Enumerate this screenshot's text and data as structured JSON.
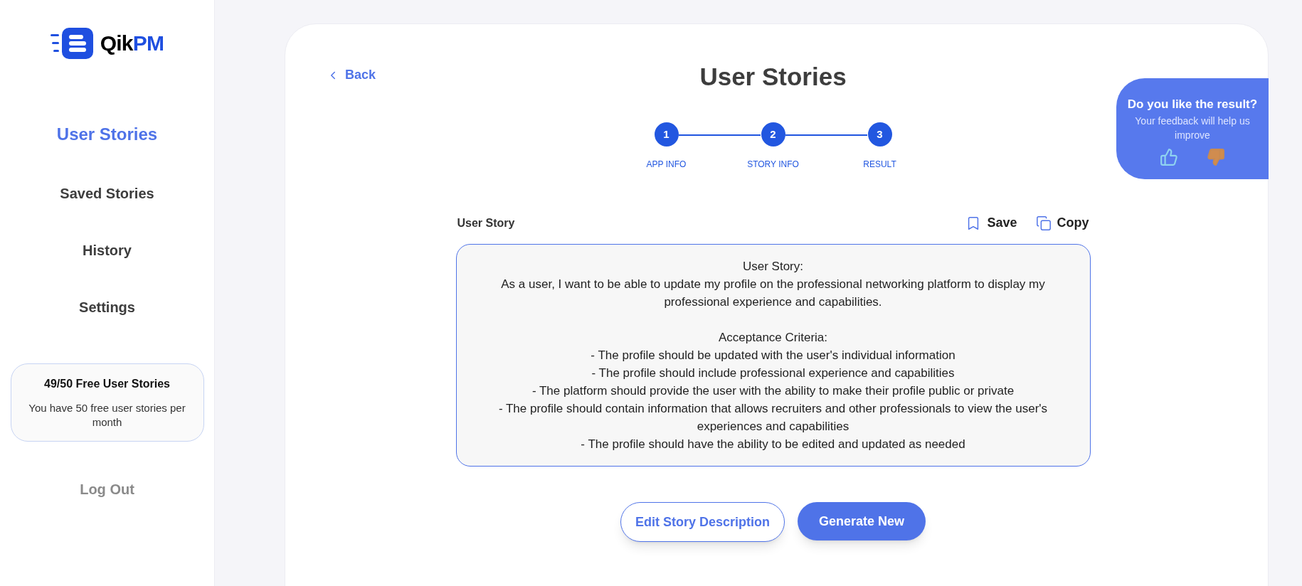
{
  "logo": {
    "first": "Qik",
    "second": "PM"
  },
  "sidebar": {
    "items": [
      {
        "label": "User Stories",
        "selected": true
      },
      {
        "label": "Saved Stories",
        "selected": false
      },
      {
        "label": "History",
        "selected": false
      },
      {
        "label": "Settings",
        "selected": false
      }
    ],
    "quota": {
      "title": "49/50 Free User Stories",
      "text": "You have 50 free user stories per month"
    },
    "logout": "Log Out"
  },
  "back": "Back",
  "title": "User Stories",
  "steps": [
    {
      "number": "1",
      "label": "APP INFO",
      "done": true
    },
    {
      "number": "2",
      "label": "STORY INFO",
      "done": true
    },
    {
      "number": "3",
      "label": "RESULT",
      "done": true
    }
  ],
  "story": {
    "label": "User Story",
    "actions": [
      "Save",
      "Copy"
    ],
    "value": "User Story:\nAs a user, I want to be able to update my profile on the professional networking platform to display my professional experience and capabilities.\n\nAcceptance Criteria:\n- The profile should be updated with the user's individual information\n- The profile should include professional experience and capabilities\n- The platform should provide the user with the ability to make their profile public or private\n- The profile should contain information that allows recruiters and other professionals to view the user's experiences and capabilities\n- The profile should have the ability to be edited and updated as needed"
  },
  "buttons": [
    {
      "label": "Edit Story Description",
      "kind": "outline"
    },
    {
      "label": "Generate New",
      "kind": "primary"
    }
  ],
  "feedback": {
    "title": "Do you like the result?",
    "text": "Your feedback will help us improve"
  }
}
